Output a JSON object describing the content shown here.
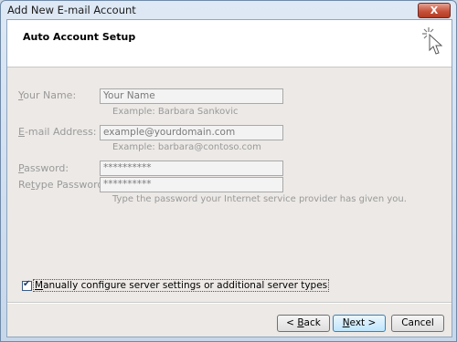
{
  "window": {
    "title": "Add New E-mail Account",
    "close_label": "X"
  },
  "header": {
    "title": "Auto Account Setup",
    "icon": "cursor-sparkle-icon"
  },
  "form": {
    "name": {
      "label_u": "Y",
      "label_rest": "our Name:",
      "value": "Your Name",
      "hint": "Example: Barbara Sankovic"
    },
    "email": {
      "label_u": "E",
      "label_rest": "-mail Address:",
      "value": "example@yourdomain.com",
      "hint": "Example: barbara@contoso.com"
    },
    "password": {
      "label_u": "P",
      "label_rest": "assword:",
      "value": "**********"
    },
    "retype": {
      "label_pre": "Re",
      "label_u": "t",
      "label_rest": "ype Password:",
      "value": "**********",
      "hint": "Type the password your Internet service provider has given you."
    }
  },
  "manual": {
    "checked": true,
    "label_u": "M",
    "label_rest": "anually configure server settings or additional server types"
  },
  "buttons": {
    "back": {
      "pre": "< ",
      "u": "B",
      "rest": "ack"
    },
    "next": {
      "u": "N",
      "rest": "ext >"
    },
    "cancel": {
      "label": "Cancel"
    }
  },
  "colors": {
    "accent": "#3c7fb1",
    "disabled_text": "#9a9a9a"
  }
}
